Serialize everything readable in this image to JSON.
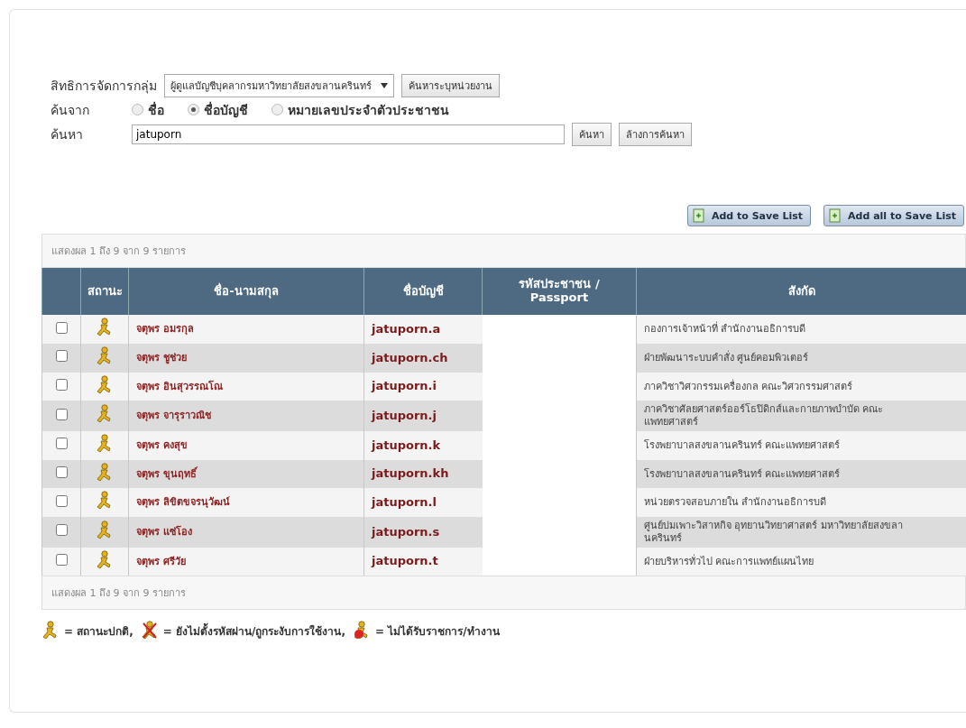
{
  "filter": {
    "group_label": "สิทธิการจัดการกลุ่ม",
    "group_value": "ผู้ดูแลบัญชีบุคลากรมหาวิทยาลัยสงขลานครินทร์",
    "unit_button": "ค้นหาระบุหน่วยงาน",
    "search_by_label": "ค้นจาก",
    "search_by": [
      {
        "label": "ชื่อ",
        "selected": false
      },
      {
        "label": "ชื่อบัญชี",
        "selected": true
      },
      {
        "label": "หมายเลขประจำตัวประชาชน",
        "selected": false
      }
    ],
    "search_label": "ค้นหา",
    "search_value": "jatuporn",
    "search_button": "ค้นหา",
    "clear_button": "ล้างการค้นหา"
  },
  "actions": [
    "Add to Save List",
    "Add all to Save List"
  ],
  "table": {
    "summary_top": "แสดงผล 1 ถึง 9 จาก 9 รายการ",
    "columns": [
      "สถานะ",
      "ชื่อ-นามสกุล",
      "ชื่อบัญชี",
      "รหัสประชาชน / Passport",
      "สังกัด"
    ],
    "rows": [
      {
        "checked": false,
        "kind": "normal",
        "name": "จตุพร อมรกุล",
        "account": "jatuporn.a",
        "affiliation": "กองการเจ้าหน้าที่ สำนักงานอธิการบดี"
      },
      {
        "checked": false,
        "kind": "normal",
        "name": "จตุพร ชูช่วย",
        "account": "jatuporn.ch",
        "affiliation": "ฝ่ายพัฒนาระบบคำสั่ง ศูนย์คอมพิวเตอร์"
      },
      {
        "checked": false,
        "kind": "normal",
        "name": "จตุพร อินสุวรรณโณ",
        "account": "jatuporn.i",
        "affiliation": "ภาควิชาวิศวกรรมเครื่องกล คณะวิศวกรรมศาสตร์"
      },
      {
        "checked": false,
        "kind": "normal",
        "name": "จตุพร จารุราวณิช",
        "account": "jatuporn.j",
        "affiliation": "ภาควิชาศัลยศาสตร์ออร์โธปิดิกส์และกายภาพบำบัด คณะแพทยศาสตร์"
      },
      {
        "checked": false,
        "kind": "normal",
        "name": "จตุพร คงสุข",
        "account": "jatuporn.k",
        "affiliation": "โรงพยาบาลสงขลานครินทร์ คณะแพทยศาสตร์"
      },
      {
        "checked": false,
        "kind": "normal",
        "name": "จตุพร ขุนฤทธิ์",
        "account": "jatuporn.kh",
        "affiliation": "โรงพยาบาลสงขลานครินทร์ คณะแพทยศาสตร์"
      },
      {
        "checked": false,
        "kind": "normal",
        "name": "จตุพร ลิขิตขจรนุวัฒน์",
        "account": "jatuporn.l",
        "affiliation": "หน่วยตรวจสอบภายใน สำนักงานอธิการบดี"
      },
      {
        "checked": false,
        "kind": "normal",
        "name": "จตุพร แซ่โอง",
        "account": "jatuporn.s",
        "affiliation": "ศูนย์บ่มเพาะวิสาหกิจ อุทยานวิทยาศาสตร์ มหาวิทยาลัยสงขลานครินทร์"
      },
      {
        "checked": false,
        "kind": "normal",
        "name": "จตุพร ศรีวัย",
        "account": "jatuporn.t",
        "affiliation": "ฝ่ายบริหารทั่วไป คณะการแพทย์แผนไทย"
      }
    ],
    "summary_bottom": "แสดงผล 1 ถึง 9 จาก 9 รายการ"
  },
  "legend": [
    {
      "kind": "normal",
      "text": "= สถานะปกติ,"
    },
    {
      "kind": "locked",
      "text": "= ยังไม่ตั้งรหัสผ่าน/ถูกระงับการใช้งาน,"
    },
    {
      "kind": "inactive",
      "text": "= ไม่ได้รับราชการ/ทำงาน"
    }
  ]
}
